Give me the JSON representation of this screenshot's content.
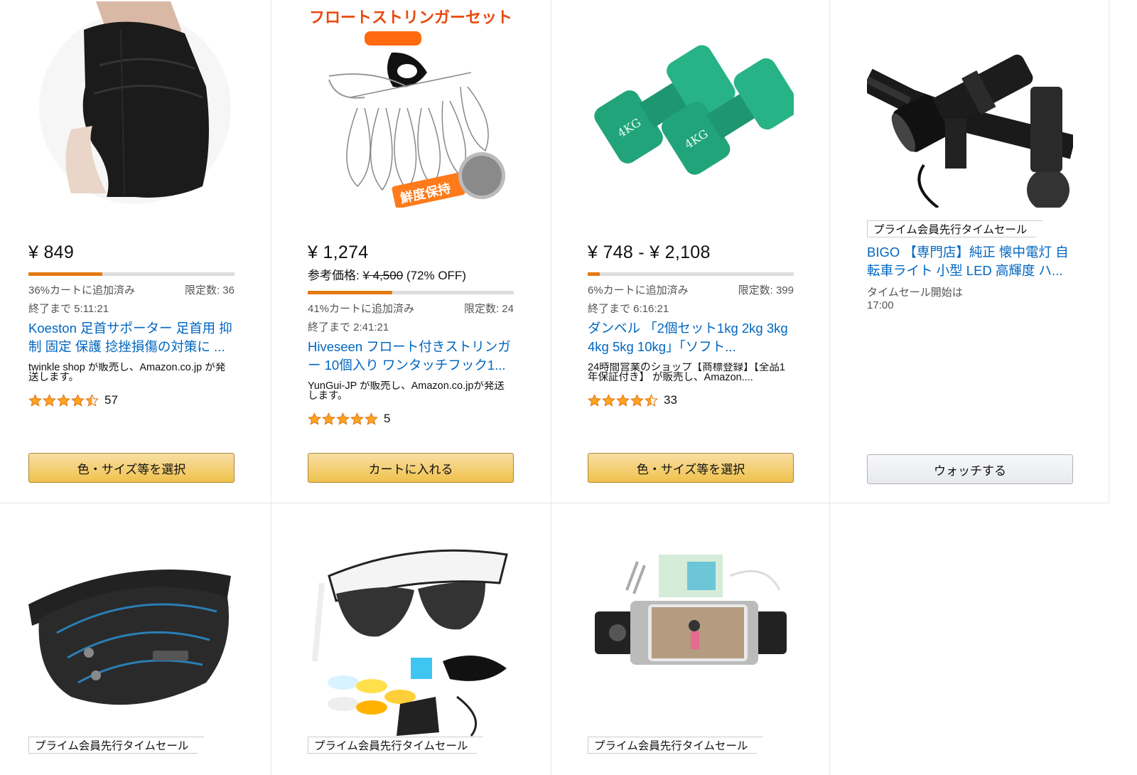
{
  "cards": [
    {
      "image": "ankle-support-image",
      "price": "¥ 849",
      "progress_pct": 36,
      "claimed": "36%カートに追加済み",
      "limit": "限定数: 36",
      "ends": "終了まで 5:11:21",
      "title": "Koeston 足首サポーター 足首用 抑制 固定 保護 捻挫損傷の対策に ...",
      "seller": "twinkle shop が販売し、Amazon.co.jp が発送します。",
      "rating_stars": 4.5,
      "review_count": "57",
      "button": "色・サイズ等を選択"
    },
    {
      "image": "fish-stringer-image",
      "image_text": "フロートストリンガーセット",
      "price": "¥ 1,274",
      "ref_label": "参考価格: ",
      "ref_price": "¥ 4,500",
      "ref_off": " (72% OFF)",
      "progress_pct": 41,
      "claimed": "41%カートに追加済み",
      "limit": "限定数: 24",
      "ends": "終了まで 2:41:21",
      "title": "Hiveseen フロート付きストリンガー 10個入り ワンタッチフック1...",
      "seller": "YunGui-JP が販売し、Amazon.co.jpが発送します。",
      "rating_stars": 5,
      "review_count": "5",
      "button": "カートに入れる"
    },
    {
      "image": "dumbbell-image",
      "price": "¥ 748 - ¥ 2,108",
      "progress_pct": 6,
      "claimed": "6%カートに追加済み",
      "limit": "限定数: 399",
      "ends": "終了まで 6:16:21",
      "title": "ダンベル 「2個セット1kg 2kg 3kg 4kg 5kg 10kg」「ソフト...",
      "seller": "24時間営業のショップ【商標登録】【全品1年保証付き】 が販売し、Amazon....",
      "rating_stars": 4.5,
      "review_count": "33",
      "button": "色・サイズ等を選択"
    },
    {
      "image": "bike-light-image",
      "badge": "プライム会員先行タイムセール",
      "title": "BIGO 【専門店】純正 懐中電灯 自転車ライト 小型 LED 高輝度 ハ...",
      "sale_start_label": "タイムセール開始は",
      "sale_start_time": "17:00",
      "button": "ウォッチする"
    },
    {
      "image": "waist-bag-image",
      "badge": "プライム会員先行タイムセール"
    },
    {
      "image": "sport-sunglasses-image",
      "badge": "プライム会員先行タイムセール"
    },
    {
      "image": "running-belt-image",
      "badge": "プライム会員先行タイムセール"
    }
  ],
  "colors": {
    "link": "#0066c0",
    "progress": "#e47911",
    "star": "#ffa41c",
    "button_yellow": "#f0c14b"
  }
}
